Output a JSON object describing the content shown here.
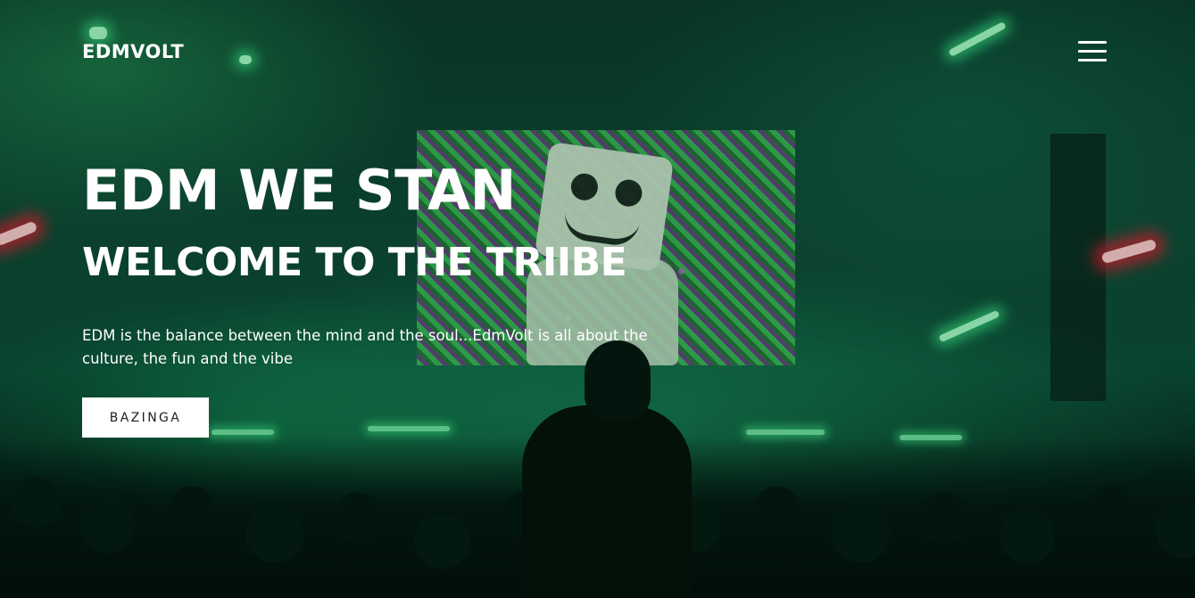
{
  "nav": {
    "brand": "EDMVOLT",
    "menu_icon": "hamburger-menu-icon"
  },
  "hero": {
    "title": "EDM WE STAN",
    "subtitle": "WELCOME TO THE TRIIBE",
    "description": "EDM is the balance between the mind and the soul...EdmVolt is all about the culture, the fun and the vibe",
    "cta_label": "BAZINGA"
  },
  "colors": {
    "text": "#ffffff",
    "button_bg": "#ffffff",
    "button_text": "#1e1e1e",
    "background_tint": "#0c4d37"
  }
}
